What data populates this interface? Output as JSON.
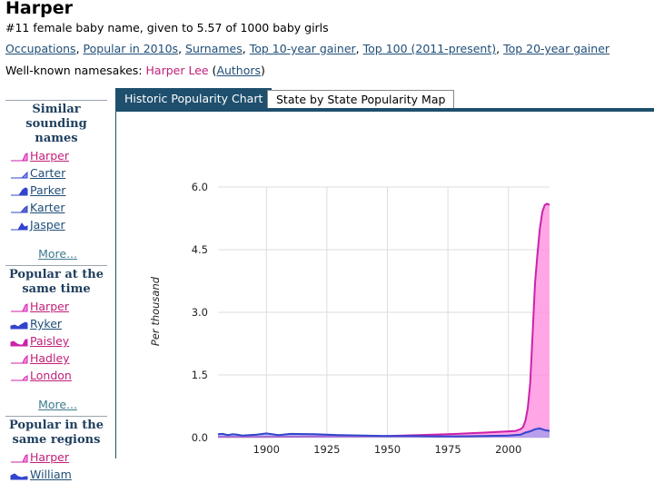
{
  "page": {
    "title": "Harper",
    "subtitle": "#11 female baby name, given to 5.57 of 1000 baby girls",
    "tags": [
      "Occupations",
      "Popular in 2010s",
      "Surnames",
      "Top 10-year gainer",
      "Top 100 (2011-present)",
      "Top 20-year gainer"
    ],
    "namesakes_label": "Well-known namesakes:",
    "namesake_name": "Harper Lee",
    "namesake_link": "Authors"
  },
  "sidebar": {
    "sections": [
      {
        "heading": "Similar sounding names",
        "items": [
          {
            "name": "Harper",
            "gender": "f"
          },
          {
            "name": "Carter",
            "gender": "m"
          },
          {
            "name": "Parker",
            "gender": "m"
          },
          {
            "name": "Karter",
            "gender": "m"
          },
          {
            "name": "Jasper",
            "gender": "m"
          }
        ],
        "more": "More..."
      },
      {
        "heading": "Popular at the same time",
        "items": [
          {
            "name": "Harper",
            "gender": "f"
          },
          {
            "name": "Ryker",
            "gender": "m"
          },
          {
            "name": "Paisley",
            "gender": "f"
          },
          {
            "name": "Hadley",
            "gender": "f"
          },
          {
            "name": "London",
            "gender": "f"
          }
        ],
        "more": "More..."
      },
      {
        "heading": "Popular in the same regions",
        "items": [
          {
            "name": "Harper",
            "gender": "f"
          },
          {
            "name": "William",
            "gender": "m"
          }
        ]
      }
    ]
  },
  "tabs": {
    "active": "Historic Popularity Chart",
    "inactive": "State by State Popularity Map"
  },
  "colors": {
    "female": "#ff88dd",
    "female_line": "#cc22aa",
    "male": "#3344cc",
    "male_fill": "#8899ee",
    "header": "#1e4f6d"
  },
  "chart_data": {
    "type": "area",
    "ylabel": "Per thousand",
    "xlim": [
      1880,
      2017
    ],
    "ylim": [
      0,
      6.0
    ],
    "y_ticks": [
      "0.0",
      "1.5",
      "3.0",
      "4.5",
      "6.0"
    ],
    "y_tick_values": [
      0,
      1.5,
      3.0,
      4.5,
      6.0
    ],
    "x_ticks": [
      "1900",
      "1925",
      "1950",
      "1975",
      "2000"
    ],
    "x_tick_values": [
      1900,
      1925,
      1950,
      1975,
      2000
    ],
    "series": [
      {
        "gender": "female",
        "x": [
          1880,
          1900,
          1925,
          1950,
          1975,
          1990,
          2000,
          2003,
          2005,
          2006,
          2007,
          2008,
          2009,
          2010,
          2011,
          2012,
          2013,
          2014,
          2015,
          2016,
          2017
        ],
        "values": [
          0.02,
          0.02,
          0.03,
          0.04,
          0.08,
          0.12,
          0.15,
          0.16,
          0.2,
          0.25,
          0.4,
          0.7,
          1.3,
          2.5,
          3.7,
          4.4,
          5.0,
          5.4,
          5.57,
          5.6,
          5.57
        ]
      },
      {
        "gender": "male",
        "x": [
          1880,
          1882,
          1884,
          1886,
          1888,
          1890,
          1893,
          1896,
          1900,
          1905,
          1910,
          1920,
          1930,
          1940,
          1950,
          1960,
          1970,
          1980,
          1990,
          2000,
          2005,
          2007,
          2009,
          2011,
          2013,
          2015,
          2017
        ],
        "values": [
          0.08,
          0.09,
          0.06,
          0.08,
          0.07,
          0.05,
          0.06,
          0.07,
          0.1,
          0.06,
          0.09,
          0.08,
          0.06,
          0.05,
          0.04,
          0.04,
          0.03,
          0.03,
          0.04,
          0.05,
          0.07,
          0.12,
          0.15,
          0.2,
          0.22,
          0.18,
          0.16
        ]
      }
    ]
  }
}
